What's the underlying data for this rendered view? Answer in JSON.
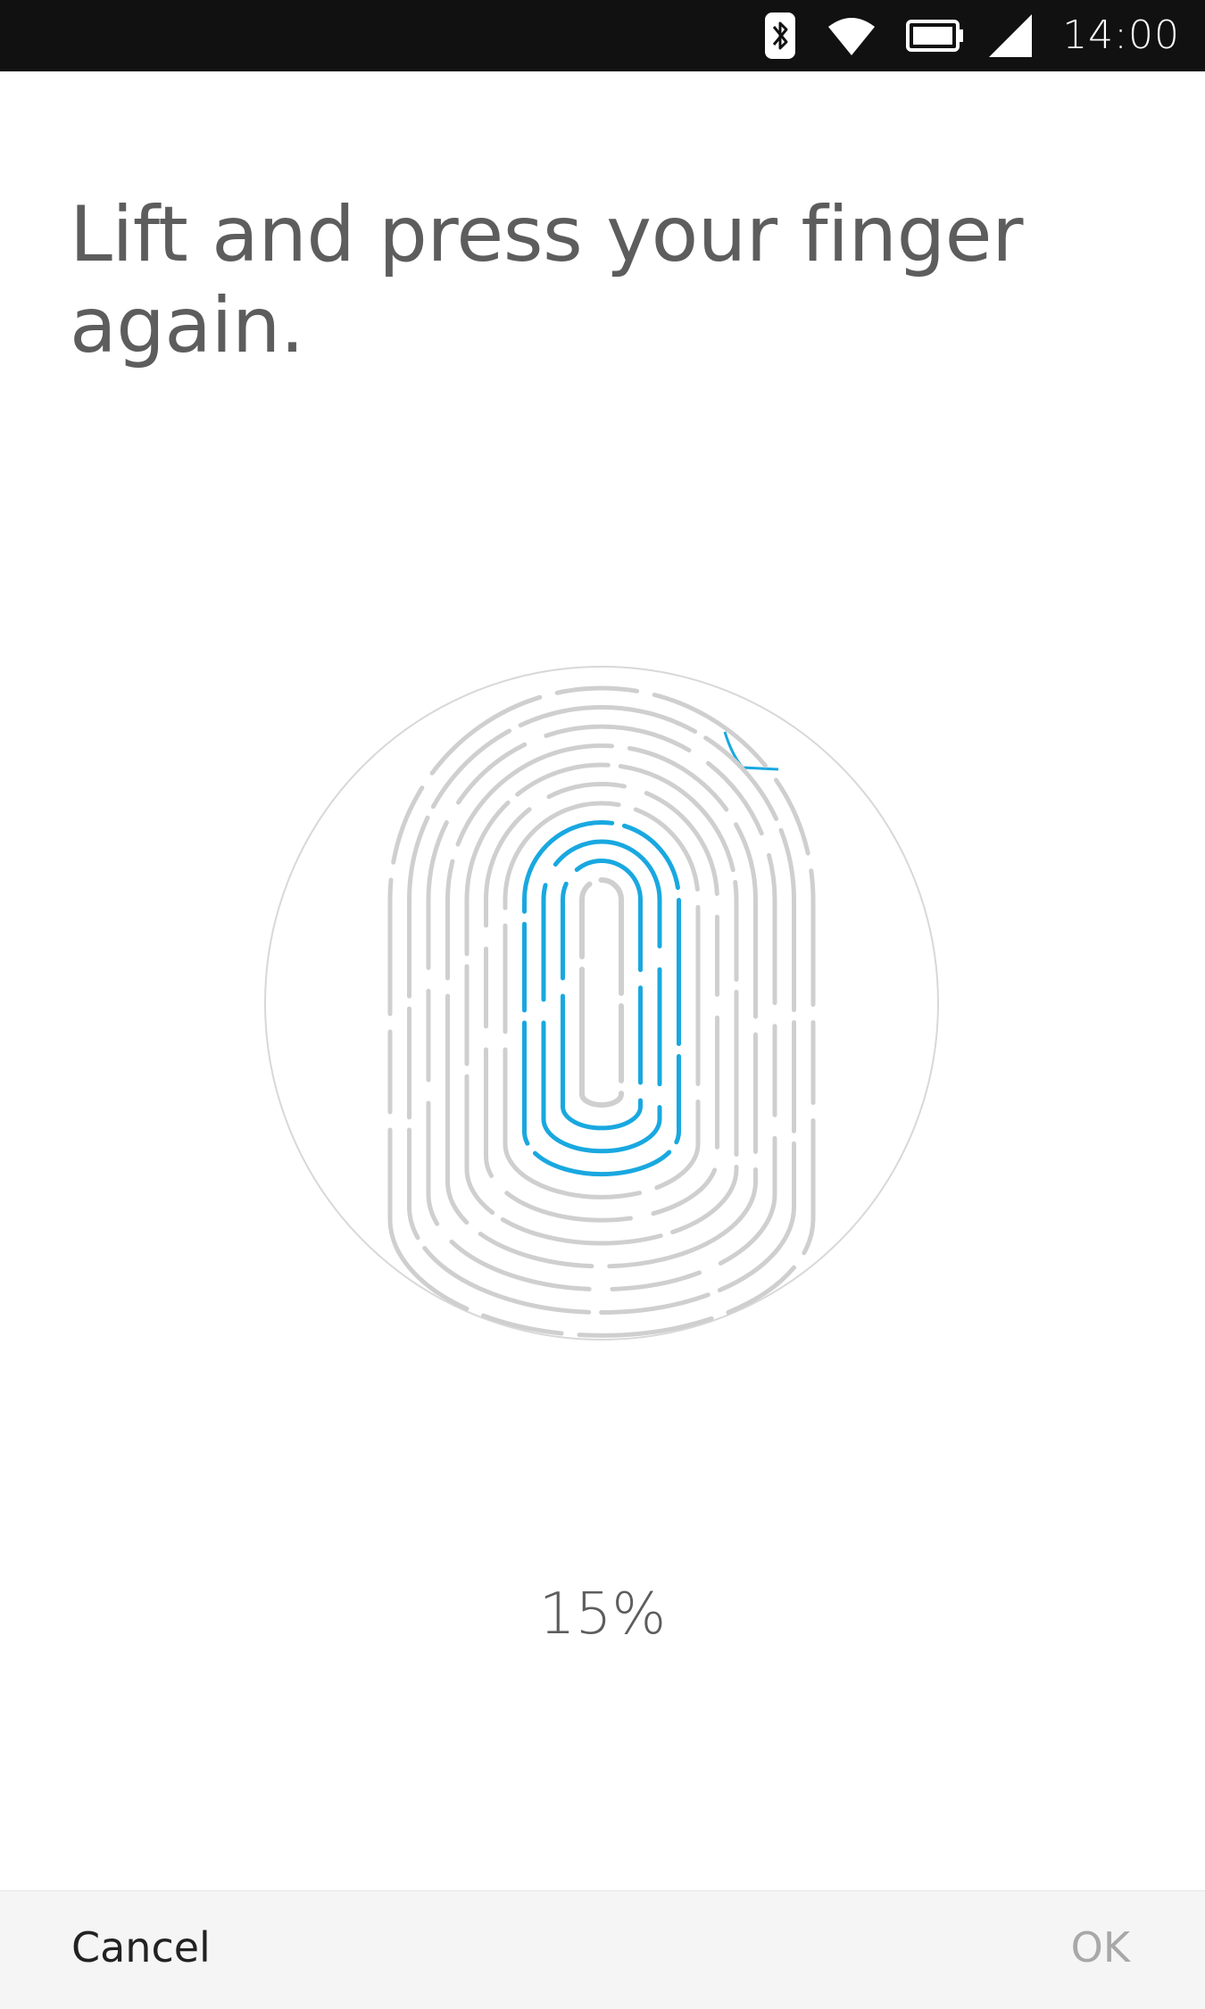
{
  "status_bar": {
    "time": "14:00",
    "icons": [
      "bluetooth-icon",
      "wifi-icon",
      "battery-icon",
      "signal-icon"
    ]
  },
  "title": "Lift and press your finger again.",
  "progress": {
    "label": "15%",
    "value_percent": 15
  },
  "buttons": {
    "cancel": "Cancel",
    "ok": "OK"
  },
  "colors": {
    "accent": "#19a8e0",
    "ridge_inactive": "#cfcfcf",
    "text": "#5d5d5d",
    "status_bar_bg": "#111111",
    "bottom_bar_bg": "#f5f5f5"
  }
}
